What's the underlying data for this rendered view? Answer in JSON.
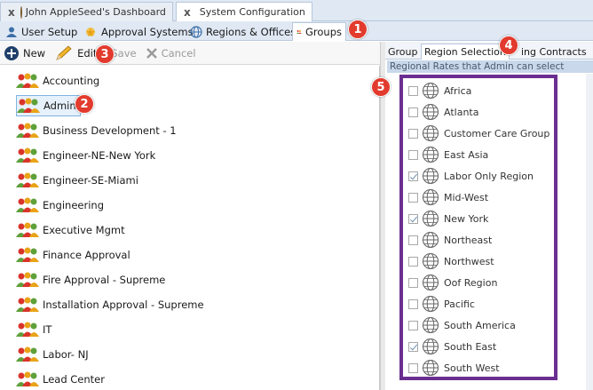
{
  "doc_tabs": [
    {
      "label": "John AppleSeed's Dashboard",
      "close": "x"
    },
    {
      "label": "System Configuration",
      "close": "x"
    }
  ],
  "section_tabs": [
    {
      "label": "User Setup"
    },
    {
      "label": "Approval Systems"
    },
    {
      "label": "Regions & Offices"
    },
    {
      "label": "Groups"
    }
  ],
  "toolbar": {
    "new_label": "New",
    "edit_label": "Edit",
    "save_label": "Save",
    "cancel_label": "Cancel"
  },
  "groups": [
    "Accounting",
    "Admin",
    "Business Development - 1",
    "Engineer-NE-New York",
    "Engineer-SE-Miami",
    "Engineering",
    "Executive Mgmt",
    "Finance Approval",
    "Fire Approval - Supreme",
    "Installation Approval - Supreme",
    "IT",
    "Labor- NJ",
    "Lead Center"
  ],
  "selected_group": "Admin",
  "right_tabs": [
    {
      "label": "Group"
    },
    {
      "label": "Region Selection"
    },
    {
      "label": "ing Contracts"
    }
  ],
  "region_header": "Regional Rates that Admin can select",
  "regions": [
    {
      "label": "Africa",
      "checked": false
    },
    {
      "label": "Atlanta",
      "checked": false
    },
    {
      "label": "Customer Care Group",
      "checked": false
    },
    {
      "label": "East Asia",
      "checked": false
    },
    {
      "label": "Labor Only Region",
      "checked": true
    },
    {
      "label": "Mid-West",
      "checked": false
    },
    {
      "label": "New York",
      "checked": true
    },
    {
      "label": "Northeast",
      "checked": false
    },
    {
      "label": "Northwest",
      "checked": false
    },
    {
      "label": "Oof Region",
      "checked": false
    },
    {
      "label": "Pacific",
      "checked": false
    },
    {
      "label": "South America",
      "checked": false
    },
    {
      "label": "South East",
      "checked": true
    },
    {
      "label": "South West",
      "checked": false
    }
  ],
  "callouts": [
    "1",
    "2",
    "3",
    "4",
    "5"
  ],
  "colors": {
    "callout": "#e23b2e",
    "highlight_box": "#6a2f90",
    "tab_strip": "#dfe8f3"
  }
}
